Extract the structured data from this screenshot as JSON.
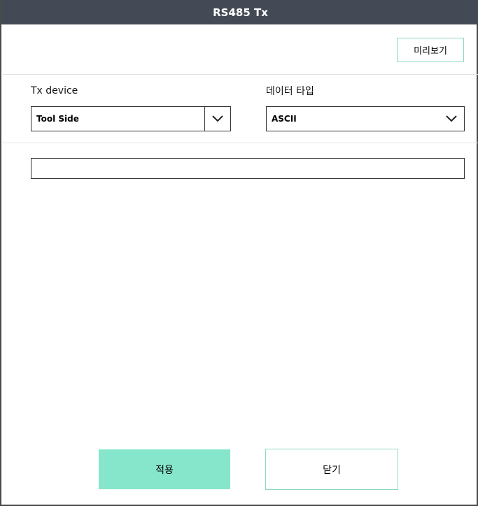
{
  "window": {
    "title": "RS485 Tx"
  },
  "toolbar": {
    "preview_label": "미리보기"
  },
  "form": {
    "tx_device": {
      "label": "Tx device",
      "value": "Tool Side"
    },
    "data_type": {
      "label": "데이터 타입",
      "value": "ASCII"
    },
    "data_input": {
      "value": "",
      "placeholder": ""
    }
  },
  "actions": {
    "apply_label": "적용",
    "close_label": "닫기"
  },
  "icons": {
    "dropdown": "chevron-down-icon"
  },
  "colors": {
    "titlebar": "#444a55",
    "accent": "#86e6cc",
    "accent_border": "#8ad9c0"
  }
}
